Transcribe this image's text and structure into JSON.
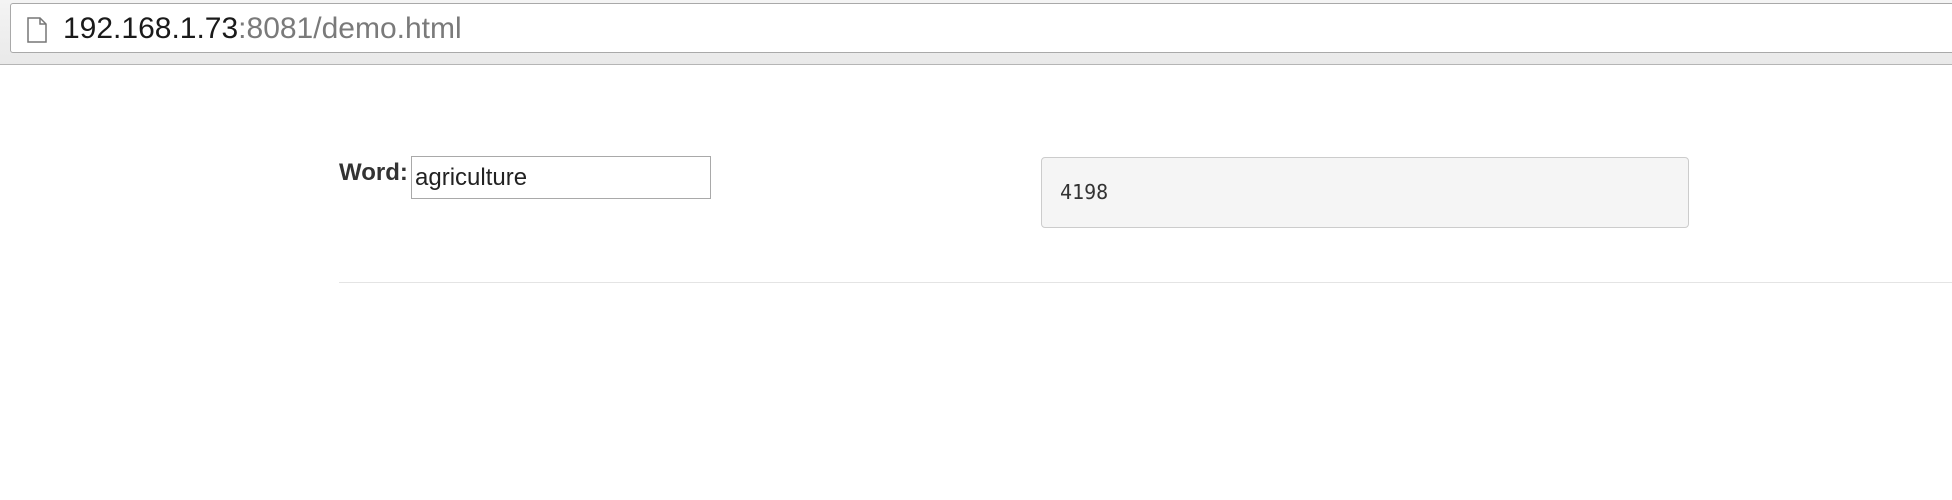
{
  "browser": {
    "url_host": "192.168.1.73",
    "url_rest": ":8081/demo.html",
    "page_icon": "document-icon"
  },
  "form": {
    "word_label": "Word:",
    "word_value": "agriculture"
  },
  "result": {
    "value": "4198"
  }
}
